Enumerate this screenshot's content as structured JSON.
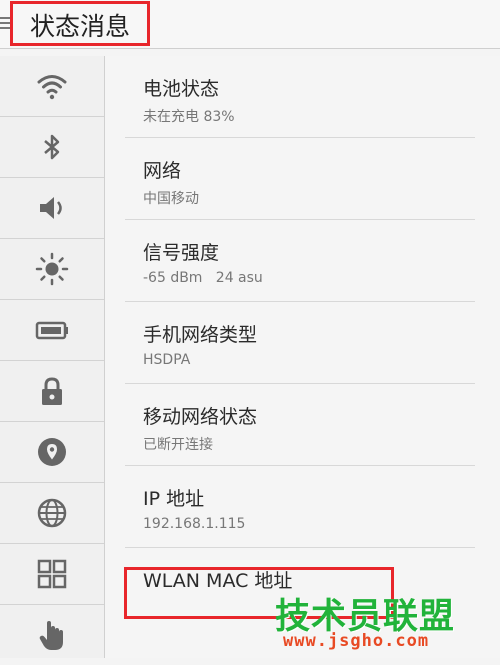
{
  "header": {
    "title": "状态消息",
    "menu_icon": "menu-icon"
  },
  "sidebar": {
    "items": [
      {
        "icon": "wifi-icon"
      },
      {
        "icon": "bluetooth-icon"
      },
      {
        "icon": "volume-icon"
      },
      {
        "icon": "brightness-icon"
      },
      {
        "icon": "battery-icon"
      },
      {
        "icon": "lock-icon"
      },
      {
        "icon": "location-icon"
      },
      {
        "icon": "globe-icon"
      },
      {
        "icon": "apps-grid-icon"
      },
      {
        "icon": "hand-pointer-icon"
      }
    ]
  },
  "settings": [
    {
      "label": "电池状态",
      "value": "未在充电  83%"
    },
    {
      "label": "网络",
      "value": "中国移动"
    },
    {
      "label": "信号强度",
      "value": "-65 dBm   24 asu"
    },
    {
      "label": "手机网络类型",
      "value": "HSDPA"
    },
    {
      "label": "移动网络状态",
      "value": "已断开连接"
    },
    {
      "label": "IP 地址",
      "value": "192.168.1.115"
    },
    {
      "label": "WLAN MAC 地址",
      "value": ""
    }
  ],
  "watermark": {
    "logo": "技术员联盟",
    "site": "www.jsgho.com"
  },
  "colors": {
    "highlight": "#e8262b",
    "watermark_green": "#21b33a",
    "watermark_orange": "#e84a24"
  }
}
